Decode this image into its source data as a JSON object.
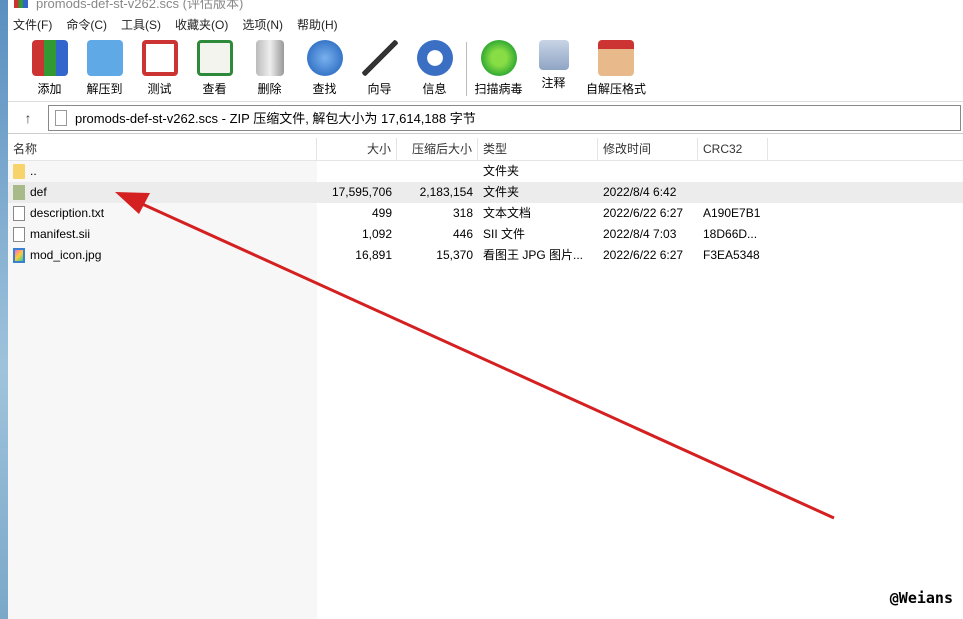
{
  "title": "promods-def-st-v262.scs (评估版本)",
  "menu": [
    "文件(F)",
    "命令(C)",
    "工具(S)",
    "收藏夹(O)",
    "选项(N)",
    "帮助(H)"
  ],
  "toolbar": [
    "添加",
    "解压到",
    "测试",
    "查看",
    "删除",
    "查找",
    "向导",
    "信息",
    "扫描病毒",
    "注释",
    "自解压格式"
  ],
  "address": "promods-def-st-v262.scs - ZIP 压缩文件, 解包大小为 17,614,188 字节",
  "columns": [
    "名称",
    "大小",
    "压缩后大小",
    "类型",
    "修改时间",
    "CRC32"
  ],
  "rows": [
    {
      "name": "..",
      "size": "",
      "packed": "",
      "type": "文件夹",
      "modified": "",
      "crc": ""
    },
    {
      "name": "def",
      "size": "17,595,706",
      "packed": "2,183,154",
      "type": "文件夹",
      "modified": "2022/8/4 6:42",
      "crc": ""
    },
    {
      "name": "description.txt",
      "size": "499",
      "packed": "318",
      "type": "文本文档",
      "modified": "2022/6/22 6:27",
      "crc": "A190E7B1"
    },
    {
      "name": "manifest.sii",
      "size": "1,092",
      "packed": "446",
      "type": "SII 文件",
      "modified": "2022/8/4 7:03",
      "crc": "18D66D..."
    },
    {
      "name": "mod_icon.jpg",
      "size": "16,891",
      "packed": "15,370",
      "type": "看图王 JPG 图片...",
      "modified": "2022/6/22 6:27",
      "crc": "F3EA5348"
    }
  ],
  "watermark": "@Weians",
  "arrow_color": "#d42020"
}
